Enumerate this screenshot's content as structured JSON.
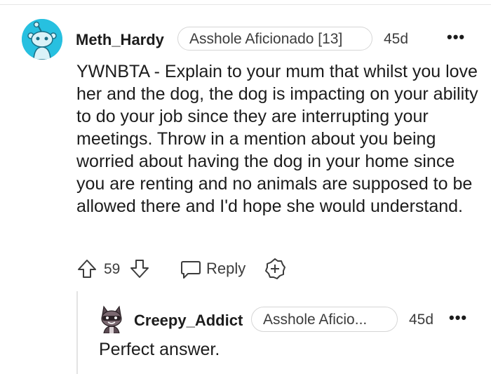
{
  "comment": {
    "author": "Meth_Hardy",
    "flair": "Asshole Aficionado [13]",
    "time": "45d",
    "more": "•••",
    "body": "YWNBTA - Explain to your mum that whilst you love her and the dog, the dog is impacting on your ability to do your job since they are interrupting your meetings. Throw in a mention about you being worried about having the dog in your home since you are renting and no animals are supposed to be allowed there and I'd hope she would understand.",
    "votes": "59",
    "reply_label": "Reply"
  },
  "reply": {
    "author": "Creepy_Addict",
    "flair": "Asshole Aficio...",
    "time": "45d",
    "more": "•••",
    "body": "Perfect answer."
  },
  "colors": {
    "avatar_bg": "#27c0e0",
    "thread_line": "#e3e3e3",
    "text": "#1c1c1c",
    "muted": "#3c3c3c"
  },
  "icons": [
    "snoo-avatar-icon",
    "upvote-icon",
    "downvote-icon",
    "comment-bubble-icon",
    "award-add-icon",
    "more-icon",
    "user-avatar-icon"
  ]
}
